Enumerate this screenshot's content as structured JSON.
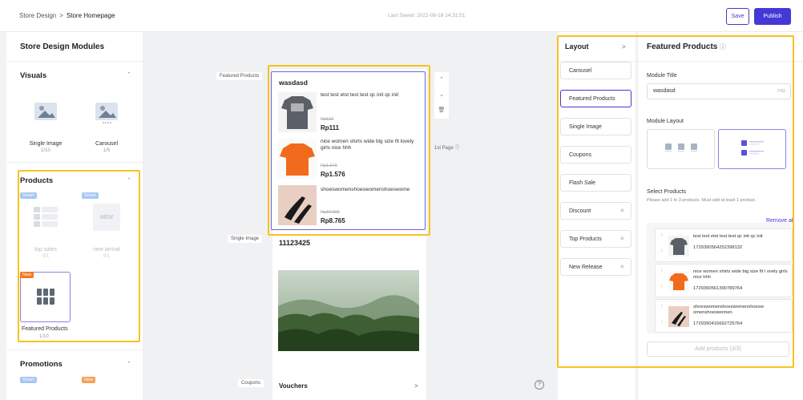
{
  "topbar": {
    "breadcrumb_root": "Store Design",
    "breadcrumb_sep": ">",
    "breadcrumb_current": "Store Homepage",
    "last_saved": "Last Saved: 2022-08-18 14:31:51",
    "save_label": "Save",
    "publish_label": "Publish",
    "accent": "#4438d6"
  },
  "sidebar": {
    "title": "Store Design Modules",
    "visuals": {
      "title": "Visuals",
      "items": [
        {
          "label": "Single Image",
          "count": "1/10"
        },
        {
          "label": "Carousel",
          "count": "1/5"
        }
      ]
    },
    "products": {
      "title": "Products",
      "items": [
        {
          "badge": "Smart",
          "label": "top sales",
          "count": "0/1"
        },
        {
          "badge": "Smart",
          "label": "new arrival",
          "count": "0/1",
          "thumb_text": "NEW"
        },
        {
          "badge": "New",
          "label": "Featured Products",
          "count": "1/10"
        }
      ]
    },
    "promotions": {
      "title": "Promotions",
      "badges": [
        "Smart",
        "New"
      ]
    }
  },
  "canvas": {
    "labels": {
      "featured": "Featured Products",
      "single_image": "Single Image",
      "coupons": "Coupons",
      "page_tag": "1st Page"
    },
    "featured": {
      "title": "wasdasd",
      "products": [
        {
          "name": "test test etst test test qc init qc init",
          "old": "Rp123",
          "price": "Rp111",
          "color": "#5b6068"
        },
        {
          "name": "nice women shirts wide big size fit lovely girls nice hhh",
          "old": "Rp1.670",
          "price": "Rp1.576",
          "color": "#f26a1b"
        },
        {
          "name": "shoeswomenshoeswomenshoeswome",
          "old": "Rp10.000",
          "price": "Rp8.765",
          "color": "#e8cfc2"
        }
      ]
    },
    "single_image_title": "11123425",
    "vouchers_title": "Vouchers",
    "vouchers_arrow": ">",
    "help": "?"
  },
  "layout_panel": {
    "title": "Layout",
    "arrow": ">",
    "items": [
      {
        "label": "Carousel"
      },
      {
        "label": "Featured Products"
      },
      {
        "label": "Single Image"
      },
      {
        "label": "Coupons"
      },
      {
        "label": "Flash Sale"
      },
      {
        "label": "Discount"
      },
      {
        "label": "Top Products"
      },
      {
        "label": "New Release"
      }
    ]
  },
  "settings": {
    "title": "Featured Products",
    "module_title_label": "Module Title",
    "module_title_value": "wasdasd",
    "module_title_count": "7/42",
    "module_layout_label": "Module Layout",
    "select_products_label": "Select Products",
    "select_products_hint": "Please add 1 to 3 products. Must add at least 1 product.",
    "remove_all": "Remove all",
    "items": [
      {
        "name": "test test etst test test qc init qc init",
        "id": "1729390564252398132"
      },
      {
        "name": "nice women shirts wide big size fit l ovely girls nice hhh",
        "id": "1729390561390789764"
      },
      {
        "name": "shoeswomenshoeswomenshoesw omenshoeswomen",
        "id": "1729390416662725764"
      }
    ],
    "add_button": "Add products (3/3)"
  }
}
